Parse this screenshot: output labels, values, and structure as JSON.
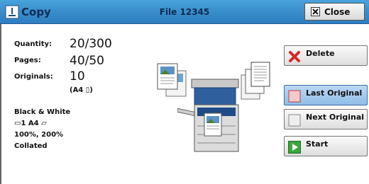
{
  "header": {
    "app_title": "Copy",
    "file_name": "File 12345",
    "close_label": "Close"
  },
  "job": {
    "quantity_label": "Quantity:",
    "quantity_value": "20/300",
    "pages_label": "Pages:",
    "pages_value": "40/50",
    "originals_label": "Originals:",
    "originals_value": "10",
    "originals_size": "(A4 ▯)"
  },
  "settings": {
    "color_mode": "Black & White",
    "tray_size": "▭1  A4 ▱",
    "zoom": "100%, 200%",
    "output": "Collated"
  },
  "actions": {
    "delete_label": "Delete",
    "last_original_label": "Last Original",
    "next_original_label": "Next Original",
    "start_label": "Start"
  },
  "colors": {
    "title_bar": "#3b90cc",
    "selected_button": "#a8cbef",
    "delete_icon": "#d42a2a",
    "start_icon": "#3aa83a"
  }
}
